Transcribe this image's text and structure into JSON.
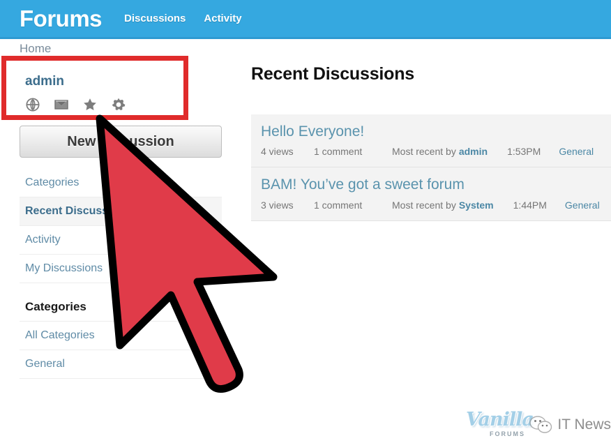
{
  "header": {
    "brand": "Forums",
    "nav": [
      {
        "label": "Discussions"
      },
      {
        "label": "Activity"
      }
    ],
    "background_color": "#35a8e0"
  },
  "breadcrumb": {
    "label": "Home"
  },
  "sidebar": {
    "user": {
      "name": "admin",
      "icons": [
        {
          "name": "globe-icon",
          "glyph": "globe"
        },
        {
          "name": "envelope-icon",
          "glyph": "envelope"
        },
        {
          "name": "star-icon",
          "glyph": "star"
        },
        {
          "name": "gear-icon",
          "glyph": "gear"
        }
      ]
    },
    "new_discussion_button": "New Discussion",
    "nav_items": [
      {
        "label": "Categories",
        "active": false
      },
      {
        "label": "Recent Discussions",
        "active": true
      },
      {
        "label": "Activity",
        "active": false
      },
      {
        "label": "My Discussions",
        "active": false
      }
    ],
    "categories_heading": "Categories",
    "category_items": [
      {
        "label": "All Categories"
      },
      {
        "label": "General"
      }
    ]
  },
  "main": {
    "title": "Recent Discussions",
    "discussions": [
      {
        "title": "Hello Everyone!",
        "views": "4 views",
        "comments": "1 comment",
        "recent_prefix": "Most recent by",
        "author": "admin",
        "time": "1:53PM",
        "category": "General"
      },
      {
        "title": "BAM! You’ve got a sweet forum",
        "views": "3 views",
        "comments": "1 comment",
        "recent_prefix": "Most recent by",
        "author": "System",
        "time": "1:44PM",
        "category": "General"
      }
    ]
  },
  "annotation": {
    "highlight_color": "#e02b2b",
    "cursor_color": "#e03b49",
    "cursor_outline": "#000000"
  },
  "watermark": {
    "vanilla_word": "Vanilla",
    "vanilla_sub": "FORUMS",
    "itnews_label": "IT News"
  }
}
